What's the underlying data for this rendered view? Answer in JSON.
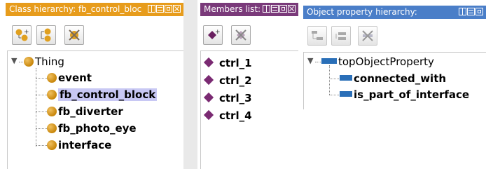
{
  "class_panel": {
    "title": "Class hierarchy: fb_control_bloc",
    "header_color": "#e79c1c",
    "toolbar_icons": [
      "add-subclass-icon",
      "add-sibling-class-icon",
      "delete-class-icon"
    ],
    "root": "Thing",
    "children": [
      "event",
      "fb_control_block",
      "fb_diverter",
      "fb_photo_eye",
      "interface"
    ],
    "selected": "fb_control_block"
  },
  "members_panel": {
    "title": "Members list:",
    "header_color": "#7a3a7a",
    "toolbar_icons": [
      "add-individual-icon",
      "delete-individual-icon"
    ],
    "items": [
      "ctrl_1",
      "ctrl_2",
      "ctrl_3",
      "ctrl_4"
    ]
  },
  "property_panel": {
    "title": "Object property hierarchy:",
    "header_color": "#4a7ec8",
    "toolbar_icons": [
      "add-subproperty-icon",
      "add-sibling-property-icon",
      "delete-property-icon"
    ],
    "root": "topObjectProperty",
    "children": [
      "connected_with",
      "is_part_of_interface"
    ]
  }
}
